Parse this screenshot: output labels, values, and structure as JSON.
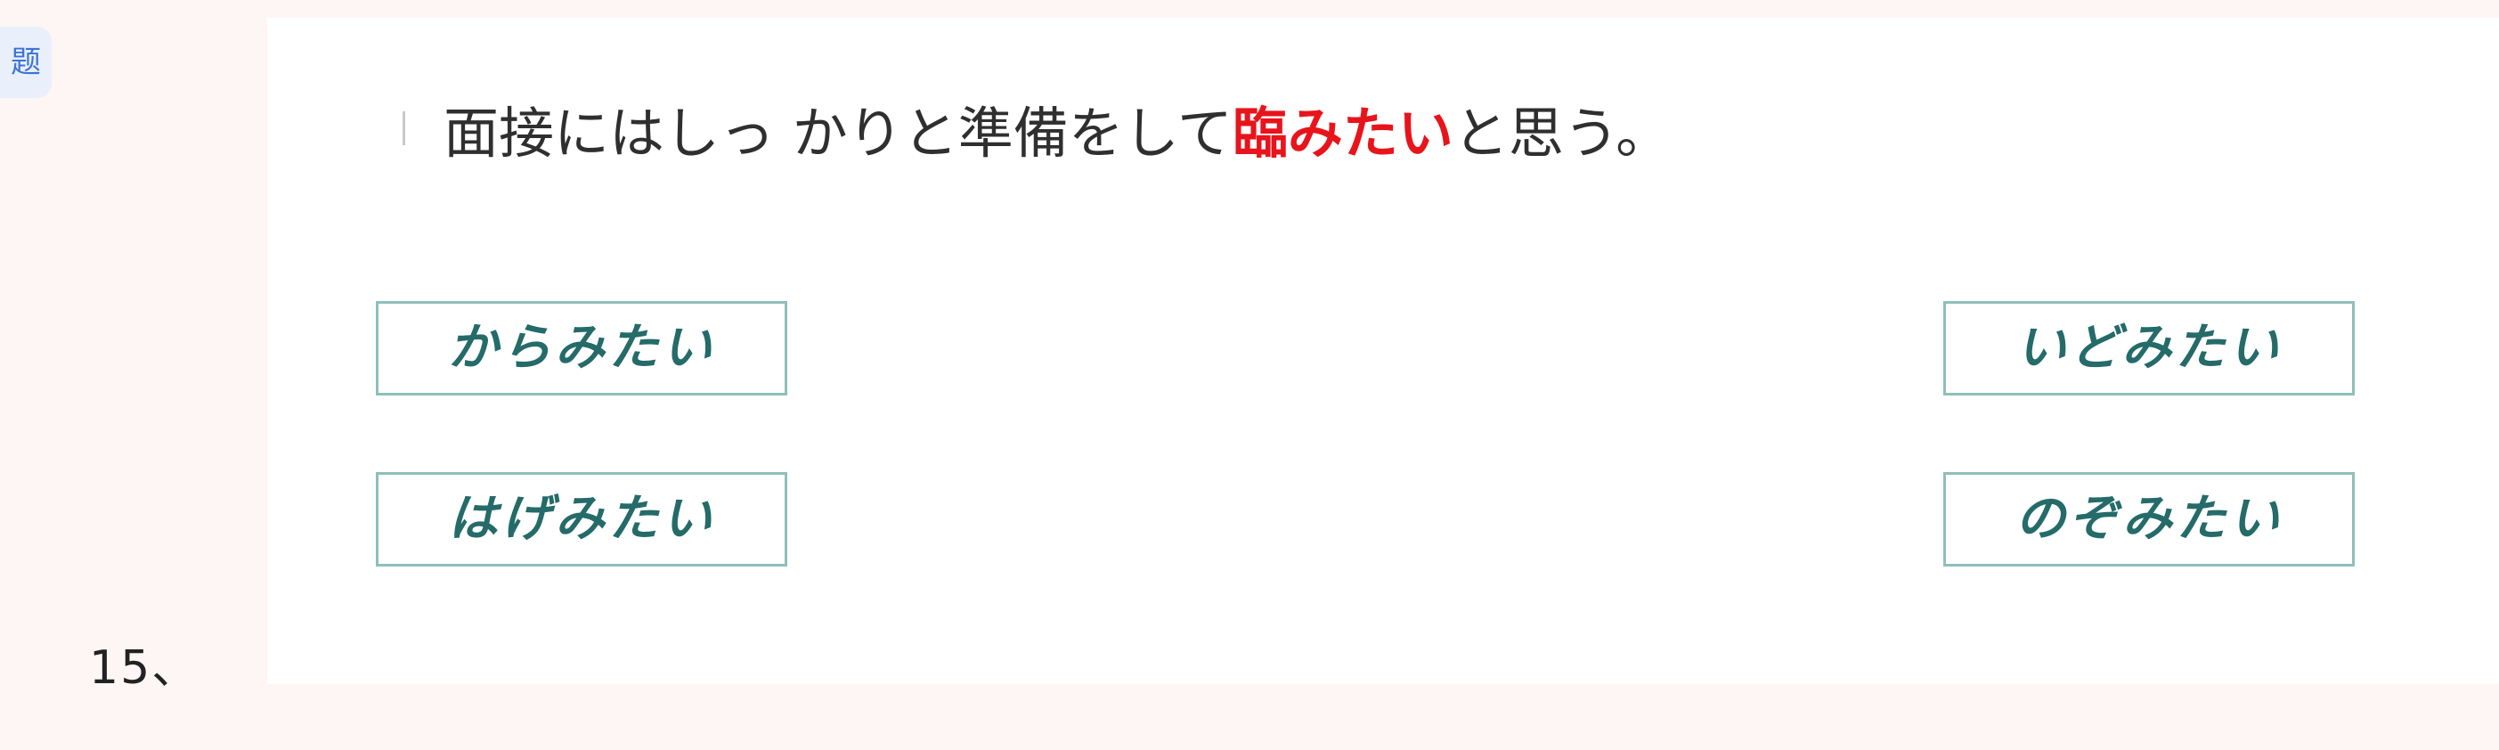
{
  "side_tab": {
    "label": "题"
  },
  "question": {
    "number": "15、",
    "sentence_before": "面接にはしっ かりと準備をして",
    "highlight": "臨みたい",
    "sentence_after": "と思う。"
  },
  "options": [
    {
      "label": "からみたい"
    },
    {
      "label": "いどみたい"
    },
    {
      "label": "はげみたい"
    },
    {
      "label": "のぞみたい"
    }
  ],
  "colors": {
    "highlight": "#e8141c",
    "option_text": "#246b69",
    "option_border": "#8fbfbb",
    "page_background": "#fdf6f5",
    "tab_text": "#3b73d9"
  }
}
